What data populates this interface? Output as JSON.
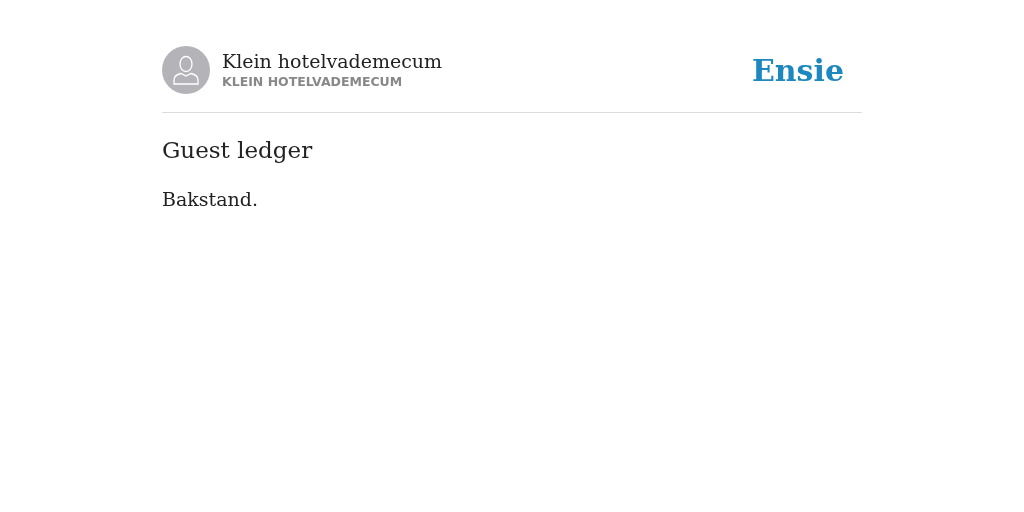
{
  "author": {
    "name": "Klein hotelvademecum",
    "handle": "KLEIN HOTELVADEMECUM"
  },
  "logo": "Ensie",
  "title": "Guest ledger",
  "body": "Bakstand."
}
